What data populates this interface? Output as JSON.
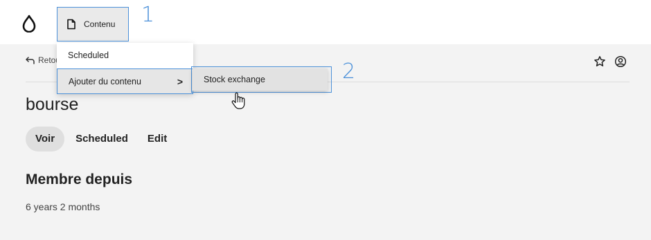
{
  "toolbar": {
    "content_label": "Contenu"
  },
  "callouts": {
    "one": "1",
    "two": "2"
  },
  "header": {
    "back_label": "Retour"
  },
  "menu": {
    "items": [
      {
        "label": "Scheduled"
      },
      {
        "label": "Ajouter du contenu",
        "chevron": ">"
      }
    ],
    "submenu": {
      "items": [
        {
          "label": "Stock exchange"
        }
      ]
    }
  },
  "page": {
    "title": "bourse",
    "tabs": [
      {
        "label": "Voir"
      },
      {
        "label": "Scheduled"
      },
      {
        "label": "Edit"
      }
    ],
    "section_title": "Membre depuis",
    "section_value": "6 years 2 months"
  },
  "colors": {
    "accent": "#4a90d9",
    "background": "#f3f3f3"
  },
  "icons": [
    "drupal-drop-icon",
    "document-icon",
    "back-arrow-icon",
    "star-icon",
    "user-icon",
    "hand-cursor-icon"
  ]
}
